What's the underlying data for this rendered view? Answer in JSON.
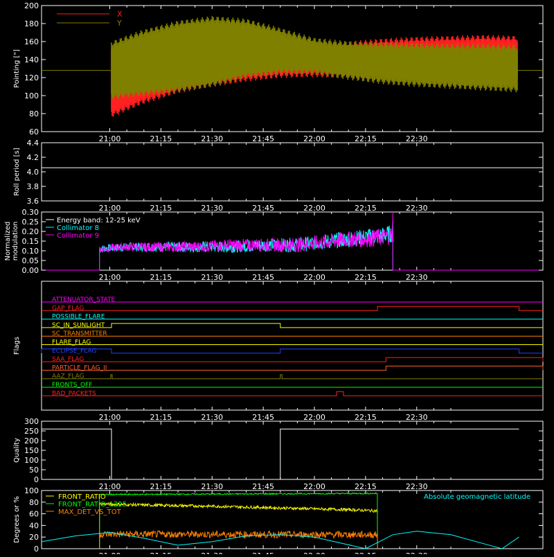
{
  "chart_data": [
    {
      "type": "line",
      "ylabel": "Pointing [\"]",
      "ylim": [
        60,
        200
      ],
      "yticks": [
        60,
        80,
        100,
        120,
        140,
        160,
        180,
        200
      ],
      "xticks": [
        "21:00",
        "21:15",
        "21:30",
        "21:45",
        "22:00",
        "22:15",
        "22:30"
      ],
      "xlim_min": [
        50,
        145
      ],
      "baseline": 128,
      "legend": [
        {
          "name": "X",
          "color": "#ff2020"
        },
        {
          "name": "Y",
          "color": "#808000"
        }
      ],
      "series": [
        {
          "name": "X",
          "color": "#ff2020",
          "x_min": [
            60.5,
            69,
            80,
            90,
            100,
            110,
            120,
            130,
            140,
            150,
            160,
            170,
            179.5
          ],
          "upper": [
            150,
            158,
            160,
            159,
            156,
            152,
            155,
            158,
            161,
            163,
            164,
            165,
            164
          ],
          "lower": [
            78,
            92,
            105,
            112,
            118,
            122,
            123,
            121,
            118,
            115,
            113,
            116,
            120
          ]
        },
        {
          "name": "Y",
          "color": "#808000",
          "x_min": [
            60.5,
            69,
            80,
            90,
            100,
            110,
            120,
            130,
            140,
            150,
            160,
            170,
            179.5
          ],
          "upper": [
            158,
            170,
            181,
            186,
            183,
            173,
            162,
            158,
            157,
            156,
            155,
            155,
            154
          ],
          "lower": [
            98,
            102,
            106,
            112,
            122,
            126,
            126,
            120,
            115,
            112,
            110,
            108,
            106
          ]
        }
      ]
    },
    {
      "type": "line",
      "ylabel": "Roll period [s]",
      "ylim": [
        3.5,
        4.5
      ],
      "yticks": [
        "3.6",
        "3.8",
        "4.0",
        "4.2",
        "4.4"
      ],
      "xticks": [
        "21:00",
        "21:15",
        "21:30",
        "21:45",
        "22:00",
        "22:15",
        "22:30"
      ],
      "series": [
        {
          "name": "Roll period",
          "color": "#ffffff",
          "value": 4.07
        }
      ]
    },
    {
      "type": "line",
      "ylabel": "Normalized modulation",
      "ylim": [
        0,
        0.3
      ],
      "yticks": [
        "0.00",
        "0.05",
        "0.10",
        "0.15",
        "0.20",
        "0.25",
        "0.30"
      ],
      "xticks": [
        "21:00",
        "21:15",
        "21:30",
        "21:45",
        "22:00",
        "22:15",
        "22:30"
      ],
      "legend": [
        {
          "name": "Energy band: 12-25 keV",
          "color": "#ffffff"
        },
        {
          "name": "Collimator 8",
          "color": "#00ffff"
        },
        {
          "name": "Collimator 9",
          "color": "#ff00ff"
        }
      ],
      "series": [
        {
          "name": "Collimator 8",
          "color": "#00ffff",
          "x_min": [
            57,
            65,
            75,
            85,
            95,
            105,
            115,
            120,
            125,
            130,
            135,
            140,
            143
          ],
          "values": [
            0.11,
            0.12,
            0.12,
            0.12,
            0.12,
            0.13,
            0.13,
            0.14,
            0.15,
            0.16,
            0.17,
            0.18,
            0.19
          ]
        },
        {
          "name": "Collimator 9",
          "color": "#ff00ff",
          "x_min": [
            57,
            65,
            75,
            85,
            95,
            105,
            115,
            120,
            125,
            130,
            135,
            140,
            143
          ],
          "values": [
            0.11,
            0.12,
            0.12,
            0.12,
            0.13,
            0.13,
            0.13,
            0.14,
            0.15,
            0.16,
            0.16,
            0.17,
            0.18
          ]
        }
      ]
    },
    {
      "type": "line",
      "ylabel": "Flags",
      "xticks": [
        "21:00",
        "21:15",
        "21:30",
        "21:45",
        "22:00",
        "22:15",
        "22:30"
      ],
      "flags": [
        {
          "name": "ATTENUATOR_STATE",
          "color": "#ff00ff",
          "on": []
        },
        {
          "name": "GAP_FLAG",
          "color": "#ff2020",
          "on": [
            [
              138.5,
              180
            ]
          ]
        },
        {
          "name": "POSSIBLE_FLARE",
          "color": "#00ffff",
          "on": []
        },
        {
          "name": "SC_IN_SUNLIGHT",
          "color": "#ffff00",
          "on": [
            [
              60.5,
              110
            ]
          ]
        },
        {
          "name": "SC_TRANSMITTER",
          "color": "#ff8000",
          "on": []
        },
        {
          "name": "FLARE_FLAG",
          "color": "#ffff00",
          "on": []
        },
        {
          "name": "ECLIPSE_FLAG",
          "color": "#2040ff",
          "on": [
            [
              40,
              60.5
            ],
            [
              110,
              180
            ]
          ]
        },
        {
          "name": "SAA_FLAG",
          "color": "#ff2020",
          "on": [
            [
              141,
              118.5
            ]
          ]
        },
        {
          "name": "PARTICLE_FLAG_II",
          "color": "#ff6030",
          "on": [
            [
              141,
              117
            ]
          ]
        },
        {
          "name": "AAZ_FLAG",
          "color": "#808000",
          "on": [
            [
              60.3,
              60.7
            ],
            [
              110,
              110.5
            ]
          ]
        },
        {
          "name": "FRONTS_OFF",
          "color": "#00ff00",
          "on": []
        },
        {
          "name": "BAD_PACKETS",
          "color": "#ff2020",
          "on": [
            [
              126.5,
              128.5
            ]
          ]
        }
      ]
    },
    {
      "type": "line",
      "ylabel": "Quality",
      "ylim": [
        0,
        300
      ],
      "yticks": [
        "0",
        "50",
        "100",
        "150",
        "200",
        "250",
        "300"
      ],
      "xticks": [
        "21:00",
        "21:15",
        "21:30",
        "21:45",
        "22:00",
        "22:15",
        "22:30"
      ],
      "series": [
        {
          "name": "Quality",
          "color": "#ffffff",
          "segments": [
            [
              40,
              60.5,
              260
            ],
            [
              60.5,
              110,
              0
            ],
            [
              110,
              180,
              260
            ]
          ]
        }
      ]
    },
    {
      "type": "line",
      "ylabel": "Degrees or %",
      "ylim": [
        0,
        100
      ],
      "yticks": [
        "0",
        "20",
        "40",
        "60",
        "80",
        "100"
      ],
      "xticks": [
        "21:00",
        "21:15",
        "21:30",
        "21:45",
        "22:00",
        "22:15",
        "22:30"
      ],
      "legend": [
        {
          "name": "FRONT_RATIO",
          "color": "#ffff00"
        },
        {
          "name": "FRONT_RATIO_1225",
          "color": "#00ff00"
        },
        {
          "name": "MAX_DET_VS_TOT",
          "color": "#ff8000"
        }
      ],
      "annotation": {
        "text": "Absolute geomagnetic latitude",
        "color": "#00ffff"
      },
      "series": [
        {
          "name": "FRONT_RATIO",
          "color": "#ffff00",
          "x_min": [
            57,
            70,
            90,
            110,
            130,
            138.5
          ],
          "values": [
            77,
            75,
            73,
            70,
            67,
            65
          ]
        },
        {
          "name": "FRONT_RATIO_1225",
          "color": "#00ff00",
          "x_min": [
            57,
            138.5
          ],
          "values": [
            93,
            95
          ]
        },
        {
          "name": "MAX_DET_VS_TOT",
          "color": "#ff8000",
          "x_min": [
            57,
            138.5
          ],
          "values": [
            25,
            24
          ]
        },
        {
          "name": "Absolute geomagnetic latitude",
          "color": "#00ffff",
          "x_min": [
            40,
            50,
            60,
            70,
            80,
            90,
            100,
            110,
            120,
            127.5,
            135,
            143,
            150,
            160,
            170,
            175,
            180
          ],
          "values": [
            12,
            22,
            28,
            18,
            6,
            12,
            22,
            24,
            20,
            10,
            0,
            24,
            30,
            24,
            8,
            0,
            20
          ]
        }
      ]
    }
  ]
}
